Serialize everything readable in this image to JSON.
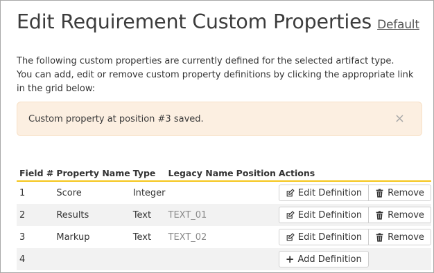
{
  "header": {
    "title": "Edit Requirement Custom Properties",
    "default_link": "Default"
  },
  "description": {
    "line1": "The following custom properties are currently defined for the selected artifact type.",
    "line2": "You can add, edit or remove custom property definitions by clicking the appropriate link in the grid below:"
  },
  "alert": {
    "message": "Custom property at position #3 saved.",
    "close_glyph": "×"
  },
  "table": {
    "headers": {
      "field": "Field #",
      "property_name": "Property Name",
      "type": "Type",
      "legacy_name": "Legacy Name",
      "position": "Position",
      "actions": "Actions"
    },
    "rows": [
      {
        "field": "1",
        "property_name": "Score",
        "type": "Integer",
        "legacy_name": "",
        "position": "",
        "edit_label": "Edit Definition",
        "remove_label": "Remove"
      },
      {
        "field": "2",
        "property_name": "Results",
        "type": "Text",
        "legacy_name": "TEXT_01",
        "position": "",
        "edit_label": "Edit Definition",
        "remove_label": "Remove"
      },
      {
        "field": "3",
        "property_name": "Markup",
        "type": "Text",
        "legacy_name": "TEXT_02",
        "position": "",
        "edit_label": "Edit Definition",
        "remove_label": "Remove"
      },
      {
        "field": "4",
        "property_name": "",
        "type": "",
        "legacy_name": "",
        "position": "",
        "add_label": "Add Definition"
      }
    ]
  },
  "icons": {
    "edit": "edit-icon",
    "remove": "trash-icon",
    "add": "plus-icon"
  },
  "colors": {
    "alert_bg": "#fcefe1",
    "header_rule": "#f5c518",
    "row_alt": "#f2f2f2"
  }
}
